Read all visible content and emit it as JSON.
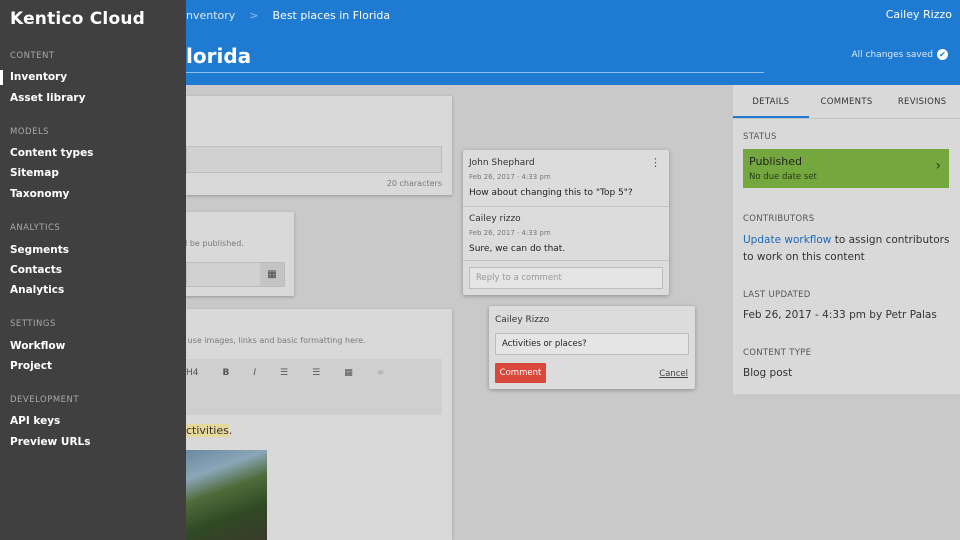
{
  "topbar": {
    "breadcrumbs": [
      "nventory",
      "Best places in Florida"
    ],
    "separator": ">",
    "user": "Cailey Rizzo"
  },
  "header": {
    "title": "lorida",
    "saved_status": "All changes saved",
    "saved_icon": "check-circle-icon"
  },
  "editor": {
    "char_count": "20 characters",
    "publish_hint": "ld be published.",
    "rte_hint": "h use images, links and basic formatting here.",
    "rte_toolbar": [
      "H4",
      "B",
      "I",
      "ordered-list-icon",
      "bullet-list-icon",
      "table-icon",
      "link-icon"
    ],
    "body_text": "ctivities",
    "body_punct": ".",
    "calendar_icon": "calendar-icon"
  },
  "comment_thread": {
    "menu_icon": "more-vertical-icon",
    "comments": [
      {
        "author": "John Shephard",
        "date": "Feb 26, 2017 · 4:33 pm",
        "text": "How about changing this to \"Top 5\"?"
      },
      {
        "author": "Cailey rizzo",
        "date": "Feb 26, 2017 · 4:33 pm",
        "text": "Sure, we can do that."
      }
    ],
    "reply_placeholder": "Reply to a comment"
  },
  "new_comment": {
    "author": "Cailey Rizzo",
    "text": "Activities or places?",
    "comment_button": "Comment",
    "cancel_button": "Cancel"
  },
  "right_panel": {
    "tabs": [
      "DETAILS",
      "COMMENTS",
      "REVISIONS"
    ],
    "active_tab": "DETAILS",
    "status_label": "STATUS",
    "status_value": "Published",
    "status_due": "No due date set",
    "contributors_label": "CONTRIBUTORS",
    "contributors_link": "Update workflow",
    "contributors_text": " to assign contributors to work on this content",
    "last_updated_label": "LAST UPDATED",
    "last_updated_value": "Feb 26, 2017 - 4:33 pm by Petr Palas",
    "content_type_label": "CONTENT TYPE",
    "content_type_value": "Blog post"
  },
  "sidebar": {
    "logo": "Kentico Cloud",
    "sections": [
      {
        "title": "CONTENT",
        "items": [
          "Inventory",
          "Asset library"
        ]
      },
      {
        "title": "MODELS",
        "items": [
          "Content types",
          "Sitemap",
          "Taxonomy"
        ]
      },
      {
        "title": "ANALYTICS",
        "items": [
          "Segments",
          "Contacts",
          "Analytics"
        ]
      },
      {
        "title": "SETTINGS",
        "items": [
          "Workflow",
          "Project"
        ]
      },
      {
        "title": "DEVELOPMENT",
        "items": [
          "API keys",
          "Preview URLs"
        ]
      }
    ],
    "active_item": "Inventory"
  },
  "colors": {
    "brand_blue": "#1f7bd1",
    "sidebar_bg": "#404040",
    "published_green": "#74a83e",
    "comment_red": "#d9483b"
  }
}
